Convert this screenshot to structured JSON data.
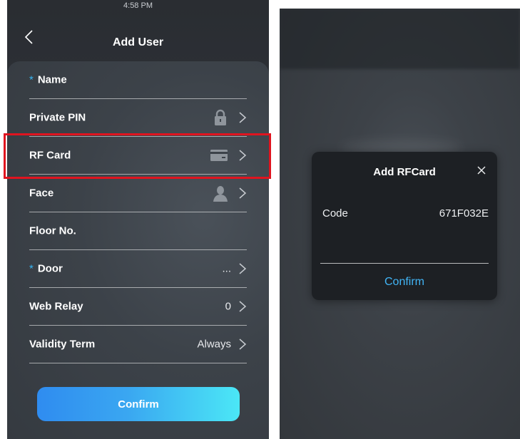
{
  "left": {
    "status_time": "4:58 PM",
    "title": "Add User",
    "rows": [
      {
        "label": "Name",
        "required": true
      },
      {
        "label": "Private PIN"
      },
      {
        "label": "RF Card"
      },
      {
        "label": "Face"
      },
      {
        "label": "Floor No."
      },
      {
        "label": "Door",
        "required": true,
        "value": "..."
      },
      {
        "label": "Web Relay",
        "value": "0"
      },
      {
        "label": "Validity Term",
        "value": "Always"
      }
    ],
    "required_mark": "*",
    "confirm_label": "Confirm",
    "icons": {
      "back": "chevron-left-icon",
      "pin": "lock-icon",
      "card": "card-icon",
      "face": "person-icon",
      "next": "chevron-right-icon"
    },
    "colors": {
      "accent": "#37b6f4",
      "highlight": "#e0141f"
    }
  },
  "modal": {
    "title": "Add RFCard",
    "code_label": "Code",
    "code_value": "671F032E",
    "confirm_label": "Confirm",
    "icons": {
      "close": "close-icon"
    }
  }
}
